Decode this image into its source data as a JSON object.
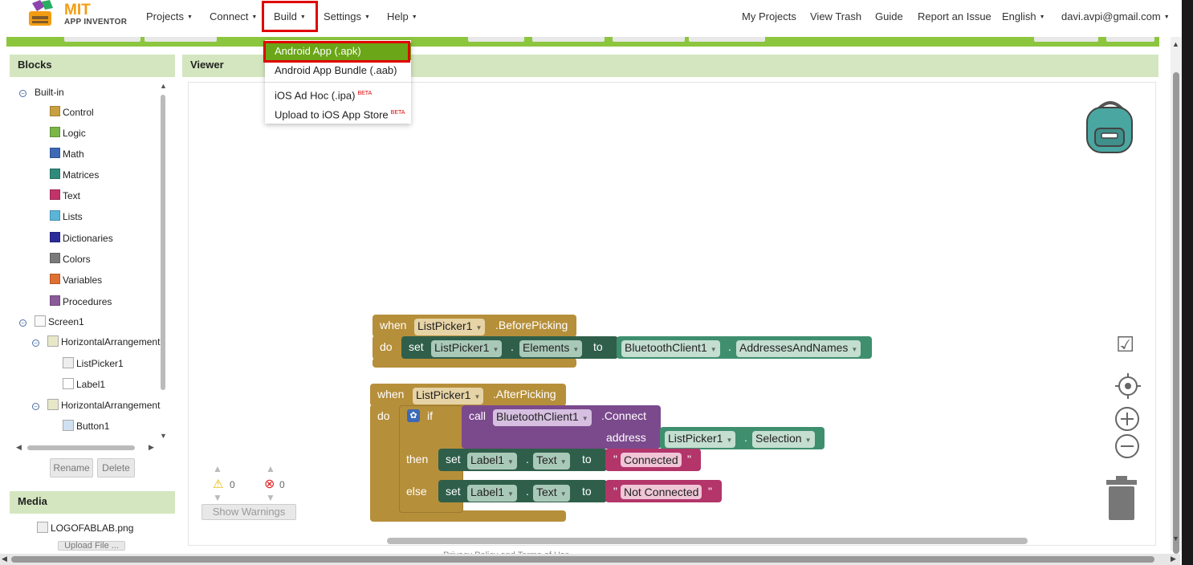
{
  "app": {
    "logo_line1": "MIT",
    "logo_line2": "APP INVENTOR"
  },
  "topnav": {
    "left": [
      {
        "label": "Projects"
      },
      {
        "label": "Connect"
      },
      {
        "label": "Build"
      },
      {
        "label": "Settings"
      },
      {
        "label": "Help"
      }
    ],
    "right": {
      "my_projects": "My Projects",
      "view_trash": "View Trash",
      "guide": "Guide",
      "report": "Report an Issue",
      "language": "English",
      "account": "davi.avpi@gmail.com"
    }
  },
  "build_menu": {
    "items": [
      {
        "label": "Android App (.apk)",
        "badge": ""
      },
      {
        "label": "Android App Bundle (.aab)",
        "badge": ""
      },
      {
        "label": "iOS Ad Hoc (.ipa)",
        "badge": "BETA"
      },
      {
        "label": "Upload to iOS App Store",
        "badge": "BETA"
      }
    ]
  },
  "blocks_panel": {
    "title": "Blocks",
    "builtin_label": "Built-in",
    "categories": [
      {
        "label": "Control",
        "color": "#c8a040"
      },
      {
        "label": "Logic",
        "color": "#7ab648"
      },
      {
        "label": "Math",
        "color": "#3d6ab6"
      },
      {
        "label": "Matrices",
        "color": "#2e8b7a"
      },
      {
        "label": "Text",
        "color": "#c2336a"
      },
      {
        "label": "Lists",
        "color": "#5bb5d9"
      },
      {
        "label": "Dictionaries",
        "color": "#2b2b99"
      },
      {
        "label": "Colors",
        "color": "#7a7a7a"
      },
      {
        "label": "Variables",
        "color": "#e07030"
      },
      {
        "label": "Procedures",
        "color": "#8a5a9a"
      }
    ],
    "screen": "Screen1",
    "components": [
      {
        "label": "HorizontalArrangement1",
        "level": 1
      },
      {
        "label": "ListPicker1",
        "level": 2
      },
      {
        "label": "Label1",
        "level": 2
      },
      {
        "label": "HorizontalArrangement2",
        "level": 1
      },
      {
        "label": "Button1",
        "level": 2
      }
    ],
    "rename": "Rename",
    "delete": "Delete"
  },
  "media_panel": {
    "title": "Media",
    "file": "LOGOFABLAB.png",
    "upload": "Upload File ..."
  },
  "viewer": {
    "title": "Viewer",
    "warnings_count": "0",
    "errors_count": "0",
    "show_warnings": "Show Warnings",
    "footer": "Privacy Policy and Terms of Use"
  },
  "blocks_code": {
    "before": {
      "when": "when",
      "component": "ListPicker1",
      "event": ".BeforePicking",
      "do": "do",
      "set": "set",
      "target": "ListPicker1",
      "dot": ".",
      "prop": "Elements",
      "to": "to",
      "src": "BluetoothClient1",
      "src_prop": "AddressesAndNames"
    },
    "after": {
      "when": "when",
      "component": "ListPicker1",
      "event": ".AfterPicking",
      "do": "do",
      "if": "if",
      "call": "call",
      "bt": "BluetoothClient1",
      "connect": ".Connect",
      "address": "address",
      "addr_comp": "ListPicker1",
      "addr_prop": "Selection",
      "then": "then",
      "else": "else",
      "set": "set",
      "label": "Label1",
      "text": "Text",
      "to": "to",
      "connected": "Connected",
      "not_connected": "Not Connected",
      "quote": "\""
    }
  },
  "colors": {
    "accent_green": "#8cc63f",
    "panel_head": "#d4e6bf",
    "highlight_red": "#e00000"
  }
}
